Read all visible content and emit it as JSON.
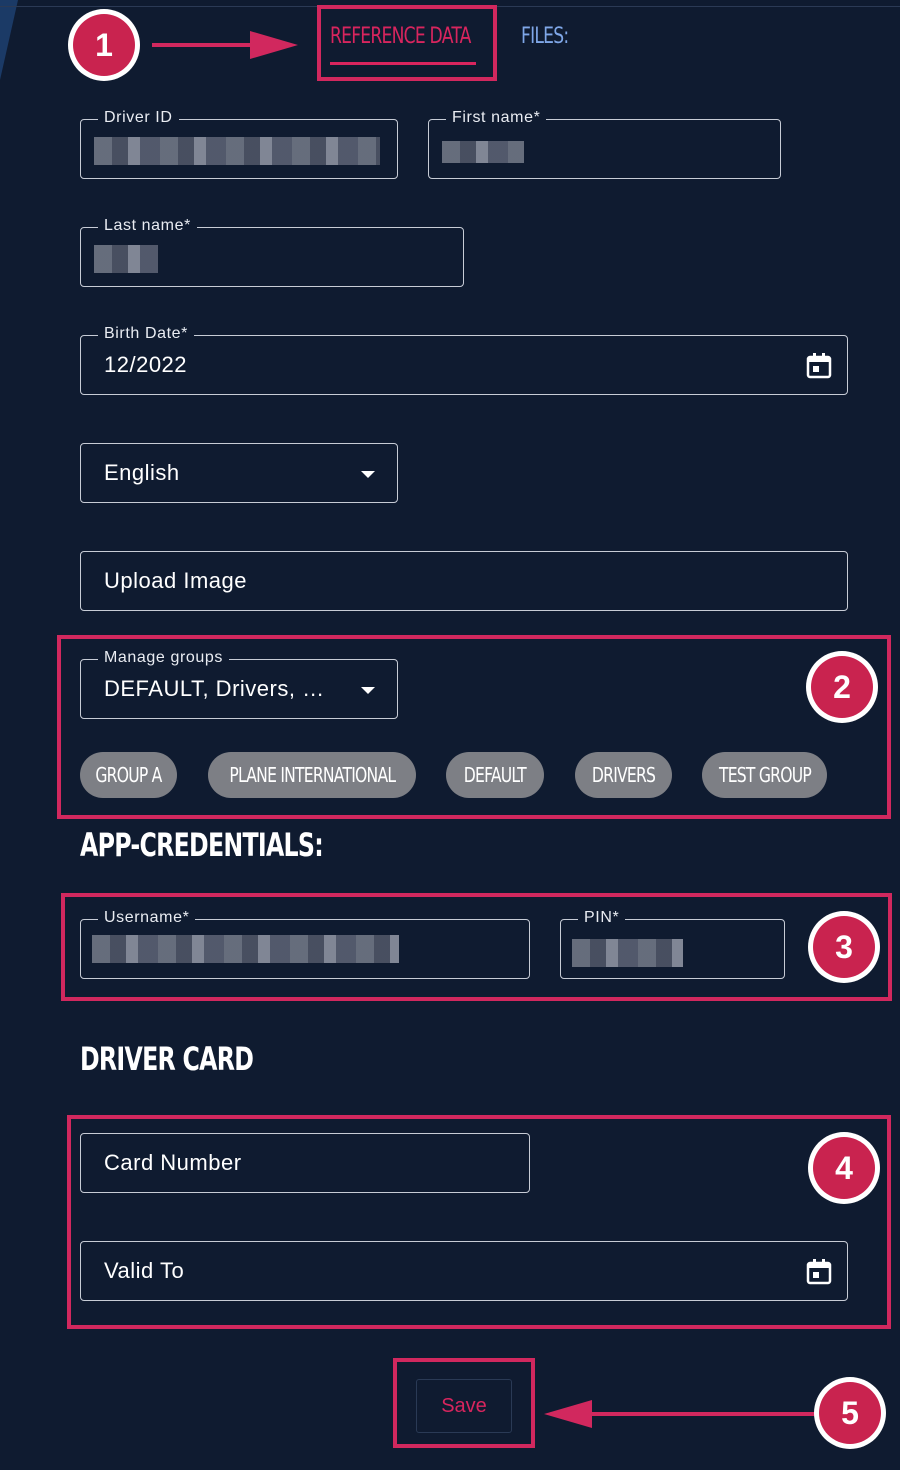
{
  "tabs": {
    "reference_data": "REFERENCE DATA",
    "files": "FILES:"
  },
  "fields": {
    "driver_id": {
      "label": "Driver ID",
      "value": ""
    },
    "first_name": {
      "label": "First name*",
      "value": ""
    },
    "last_name": {
      "label": "Last name*",
      "value": ""
    },
    "birth_date": {
      "label": "Birth Date*",
      "value": "12/2022"
    },
    "language": {
      "value": "English"
    },
    "upload_image": {
      "placeholder": "Upload Image"
    },
    "manage_groups": {
      "label": "Manage groups",
      "value": "DEFAULT, Drivers, …"
    }
  },
  "groups": [
    "GROUP A",
    "PLANE INTERNATIONAL",
    "DEFAULT",
    "DRIVERS",
    "TEST GROUP"
  ],
  "app_credentials": {
    "heading": "APP-CREDENTIALS:",
    "username": {
      "label": "Username*",
      "value": ""
    },
    "pin": {
      "label": "PIN*",
      "value": ""
    }
  },
  "driver_card": {
    "heading": "DRIVER CARD",
    "card_number": {
      "placeholder": "Card Number"
    },
    "valid_to": {
      "placeholder": "Valid To"
    }
  },
  "save_label": "Save",
  "annotations": [
    "1",
    "2",
    "3",
    "4",
    "5"
  ],
  "colors": {
    "background": "#0f1b30",
    "accent": "#d8255e",
    "files_tab": "#7fa7e8",
    "chip": "#7d7f85"
  },
  "icons": [
    "calendar-icon",
    "dropdown-arrow-icon",
    "arrow-right-icon",
    "arrow-left-icon"
  ]
}
